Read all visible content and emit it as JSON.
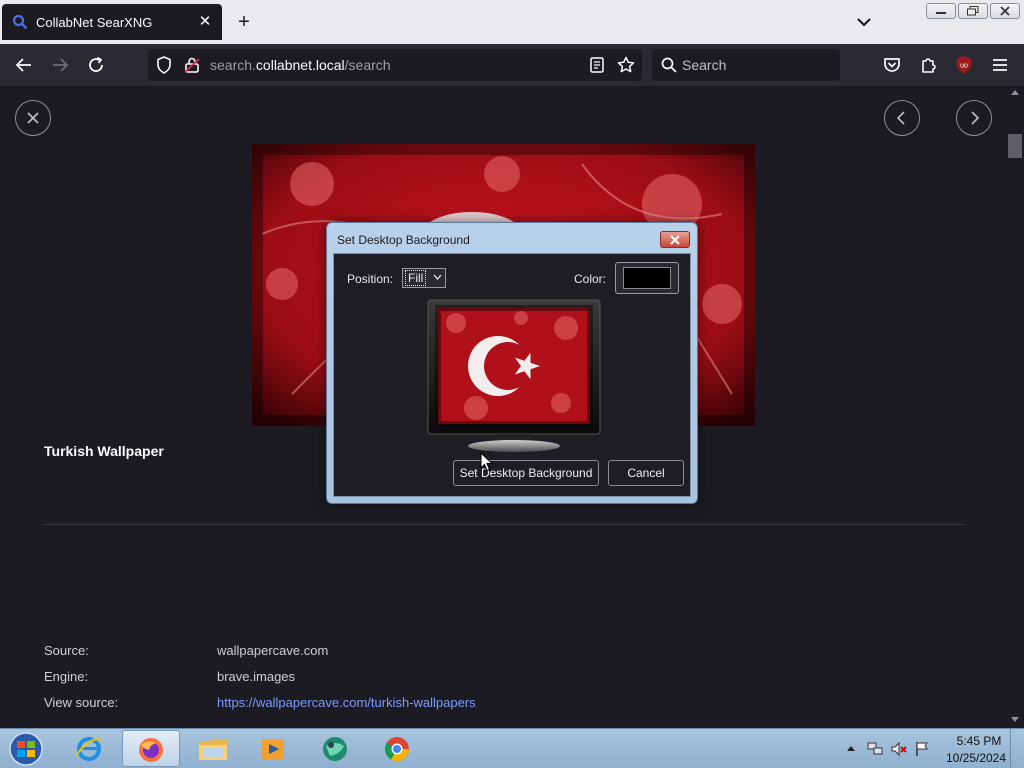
{
  "browser": {
    "tab_title": "CollabNet SearXNG",
    "url_domain": "collabnet.local",
    "url_prefix": "search.",
    "url_path": "/search",
    "search_placeholder": "Search"
  },
  "page": {
    "image_title": "Turkish Wallpaper",
    "meta": [
      {
        "label": "Source:",
        "value": "wallpapercave.com"
      },
      {
        "label": "Engine:",
        "value": "brave.images"
      },
      {
        "label": "View source:",
        "value": "https://wallpapercave.com/turkish-wallpapers"
      }
    ]
  },
  "dialog": {
    "title": "Set Desktop Background",
    "position_label": "Position:",
    "position_value": "Fill",
    "color_label": "Color:",
    "color_value": "#000000",
    "set_button": "Set Desktop Background",
    "cancel_button": "Cancel"
  },
  "taskbar": {
    "items": [
      "start-orb",
      "internet-explorer",
      "firefox",
      "file-explorer",
      "media-player",
      "app-globe",
      "chrome"
    ],
    "active": "firefox",
    "time": "5:45 PM",
    "date": "10/25/2024"
  },
  "colors": {
    "page_bg": "#1c1b22",
    "toolbar_bg": "#2b2a33",
    "accent_link": "#7a9cff",
    "flag_red": "#d8121f"
  }
}
